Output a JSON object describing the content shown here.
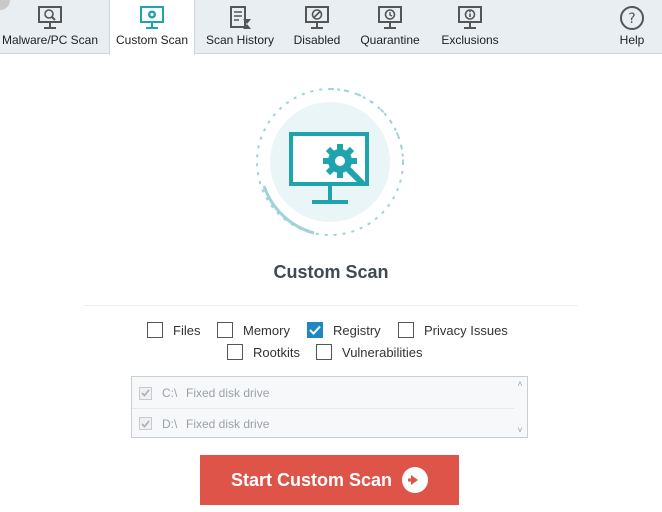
{
  "toolbar": {
    "tabs": [
      {
        "label": "Malware/PC Scan",
        "icon": "pc-scan-icon"
      },
      {
        "label": "Custom Scan",
        "icon": "custom-scan-icon"
      },
      {
        "label": "Scan History",
        "icon": "scan-history-icon"
      },
      {
        "label": "Disabled",
        "icon": "disabled-icon"
      },
      {
        "label": "Quarantine",
        "icon": "quarantine-icon"
      },
      {
        "label": "Exclusions",
        "icon": "exclusions-icon"
      },
      {
        "label": "Help",
        "icon": "help-icon"
      }
    ],
    "active_tab": "Custom Scan"
  },
  "main": {
    "title": "Custom Scan",
    "options": [
      {
        "label": "Files",
        "checked": false
      },
      {
        "label": "Memory",
        "checked": false
      },
      {
        "label": "Registry",
        "checked": true
      },
      {
        "label": "Privacy Issues",
        "checked": false
      },
      {
        "label": "Rootkits",
        "checked": false
      },
      {
        "label": "Vulnerabilities",
        "checked": false
      }
    ],
    "drives": [
      {
        "name": "C:\\",
        "type": "Fixed disk drive",
        "checked": true
      },
      {
        "name": "D:\\",
        "type": "Fixed disk drive",
        "checked": true
      }
    ],
    "start_label": "Start Custom Scan"
  },
  "colors": {
    "accent": "#1e88c4",
    "teal": "#1fa3ad",
    "button": "#df5448"
  }
}
